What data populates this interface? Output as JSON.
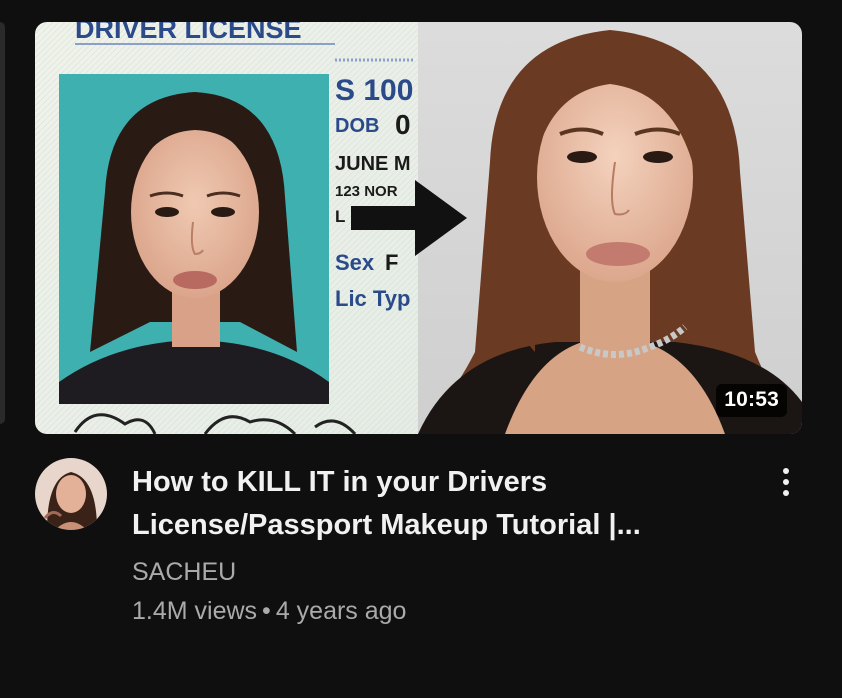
{
  "video": {
    "duration": "10:53",
    "title": "How to KILL IT in your Drivers License/Passport Makeup Tutorial |...",
    "channel": "SACHEU",
    "views": "1.4M views",
    "separator": "•",
    "age": "4 years ago"
  },
  "thumbnail": {
    "license_header": "DRIVER LICENSE",
    "license_number": "S 100",
    "dob_label": "DOB",
    "dob_value": "0",
    "month": "JUNE M",
    "address": "123 NOR",
    "line_l": "L",
    "sex_label": "Sex",
    "sex_value": "F",
    "lic_type": "Lic Typ"
  },
  "icons": {
    "menu": "more-vert-icon",
    "arrow": "right-arrow-icon"
  },
  "colors": {
    "background": "#0f0f0f",
    "title": "#f1f1f1",
    "secondary": "#aaaaaa",
    "badge_bg": "#000000",
    "photo_bg": "#3fb0b0"
  }
}
